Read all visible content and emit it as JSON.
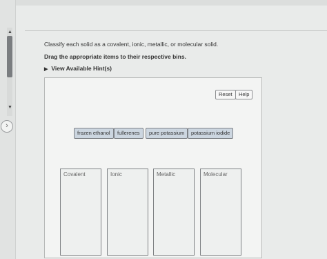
{
  "question": {
    "prompt": "Classify each solid as a covalent, ionic, metallic, or molecular solid.",
    "instruction": "Drag the appropriate items to their respective bins.",
    "hints_label": "View Available Hint(s)"
  },
  "toolbar": {
    "reset_label": "Reset",
    "help_label": "Help"
  },
  "items": [
    {
      "label": "frozen ethanol"
    },
    {
      "label": "fullerenes"
    },
    {
      "label": "pure potassium"
    },
    {
      "label": "potassium iodide"
    }
  ],
  "bins": [
    {
      "label": "Covalent"
    },
    {
      "label": "Ionic"
    },
    {
      "label": "Metallic"
    },
    {
      "label": "Molecular"
    }
  ],
  "icons": {
    "hint_toggle": "triangle-right-icon",
    "side_nav": "chevron-right-icon"
  }
}
